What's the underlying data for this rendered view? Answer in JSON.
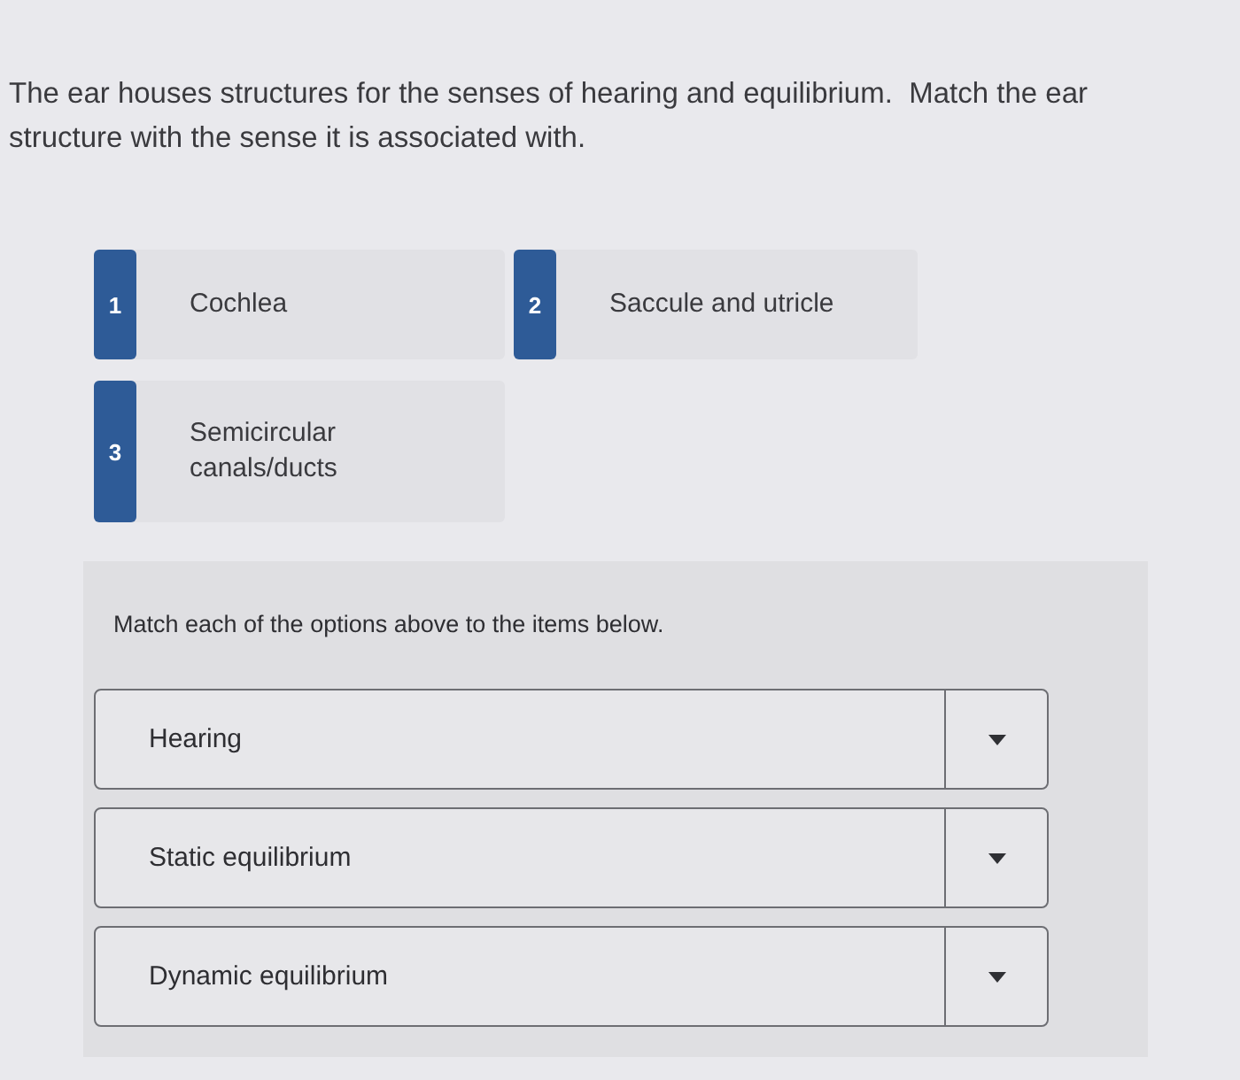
{
  "question": {
    "text": "The ear houses structures for the senses of hearing and equilibrium.  Match the ear structure with the sense it is associated with."
  },
  "options": [
    {
      "number": "1",
      "label": "Cochlea"
    },
    {
      "number": "2",
      "label": "Saccule and utricle"
    },
    {
      "number": "3",
      "label": "Semicircular canals/ducts"
    }
  ],
  "matching": {
    "instruction": "Match each of the options above to the items below.",
    "items": [
      {
        "label": "Hearing"
      },
      {
        "label": "Static equilibrium"
      },
      {
        "label": "Dynamic equilibrium"
      }
    ]
  }
}
